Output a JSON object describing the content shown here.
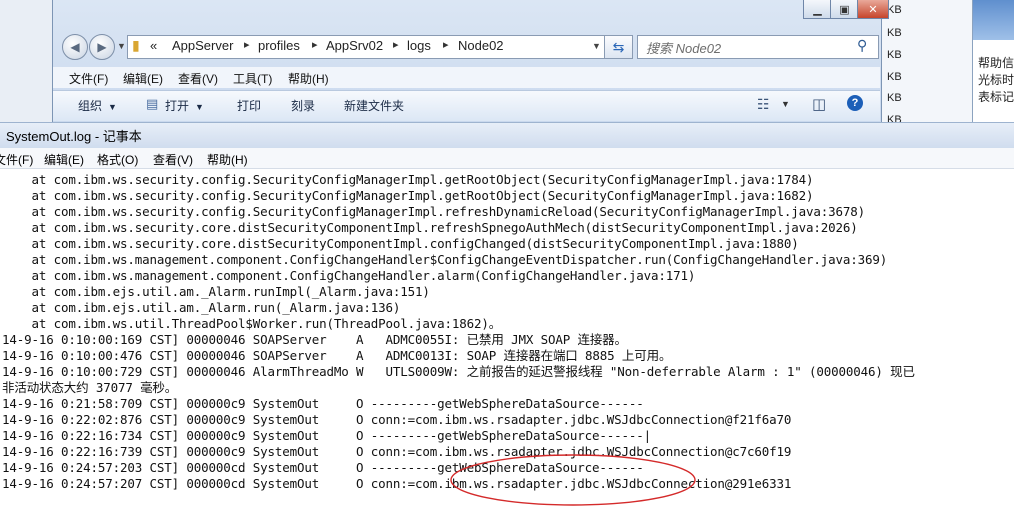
{
  "explorer": {
    "breadcrumb_prefix": "«",
    "breadcrumbs": [
      "AppServer",
      "profiles",
      "AppSrv02",
      "logs",
      "Node02"
    ],
    "search_placeholder": "搜索 Node02",
    "menu": [
      "文件(F)",
      "编辑(E)",
      "查看(V)",
      "工具(T)",
      "帮助(H)"
    ],
    "commands": {
      "organize": "组织",
      "open": "打开",
      "print": "打印",
      "burn": "刻录",
      "new_folder": "新建文件夹"
    },
    "file_sizes": [
      "KB",
      "KB",
      "KB",
      "KB",
      "KB",
      "KB"
    ]
  },
  "background_window": {
    "help_lines": [
      "帮助信",
      "光标时",
      "表标记"
    ]
  },
  "notepad": {
    "title": "SystemOut.log - 记事本",
    "menu": [
      "文件(F)",
      "编辑(E)",
      "格式(O)",
      "查看(V)",
      "帮助(H)"
    ],
    "lines": [
      "    at com.ibm.ws.security.config.SecurityConfigManagerImpl.getRootObject(SecurityConfigManagerImpl.java:1784)",
      "    at com.ibm.ws.security.config.SecurityConfigManagerImpl.getRootObject(SecurityConfigManagerImpl.java:1682)",
      "    at com.ibm.ws.security.config.SecurityConfigManagerImpl.refreshDynamicReload(SecurityConfigManagerImpl.java:3678)",
      "    at com.ibm.ws.security.core.distSecurityComponentImpl.refreshSpnegoAuthMech(distSecurityComponentImpl.java:2026)",
      "    at com.ibm.ws.security.core.distSecurityComponentImpl.configChanged(distSecurityComponentImpl.java:1880)",
      "    at com.ibm.ws.management.component.ConfigChangeHandler$ConfigChangeEventDispatcher.run(ConfigChangeHandler.java:369)",
      "    at com.ibm.ws.management.component.ConfigChangeHandler.alarm(ConfigChangeHandler.java:171)",
      "    at com.ibm.ejs.util.am._Alarm.runImpl(_Alarm.java:151)",
      "    at com.ibm.ejs.util.am._Alarm.run(_Alarm.java:136)",
      "    at com.ibm.ws.util.ThreadPool$Worker.run(ThreadPool.java:1862)。",
      "14-9-16 0:10:00:169 CST] 00000046 SOAPServer    A   ADMC0055I: 已禁用 JMX SOAP 连接器。",
      "14-9-16 0:10:00:476 CST] 00000046 SOAPServer    A   ADMC0013I: SOAP 连接器在端口 8885 上可用。",
      "14-9-16 0:10:00:729 CST] 00000046 AlarmThreadMo W   UTLS0009W: 之前报告的延迟警报线程 \"Non-deferrable Alarm : 1\" (00000046) 现已",
      "非活动状态大约 37077 毫秒。",
      "14-9-16 0:21:58:709 CST] 000000c9 SystemOut     O ---------getWebSphereDataSource------",
      "14-9-16 0:22:02:876 CST] 000000c9 SystemOut     O conn:=com.ibm.ws.rsadapter.jdbc.WSJdbcConnection@f21f6a70",
      "14-9-16 0:22:16:734 CST] 000000c9 SystemOut     O ---------getWebSphereDataSource------|",
      "14-9-16 0:22:16:739 CST] 000000c9 SystemOut     O conn:=com.ibm.ws.rsadapter.jdbc.WSJdbcConnection@c7c60f19",
      "14-9-16 0:24:57:203 CST] 000000cd SystemOut     O ---------getWebSphereDataSource------",
      "14-9-16 0:24:57:207 CST] 000000cd SystemOut     O conn:=com.ibm.ws.rsadapter.jdbc.WSJdbcConnection@291e6331"
    ]
  },
  "colors": {
    "annotation_ellipse": "#d42a2a",
    "explorer_chrome": "#cad9ee",
    "help_icon": "#1c5fb8"
  }
}
